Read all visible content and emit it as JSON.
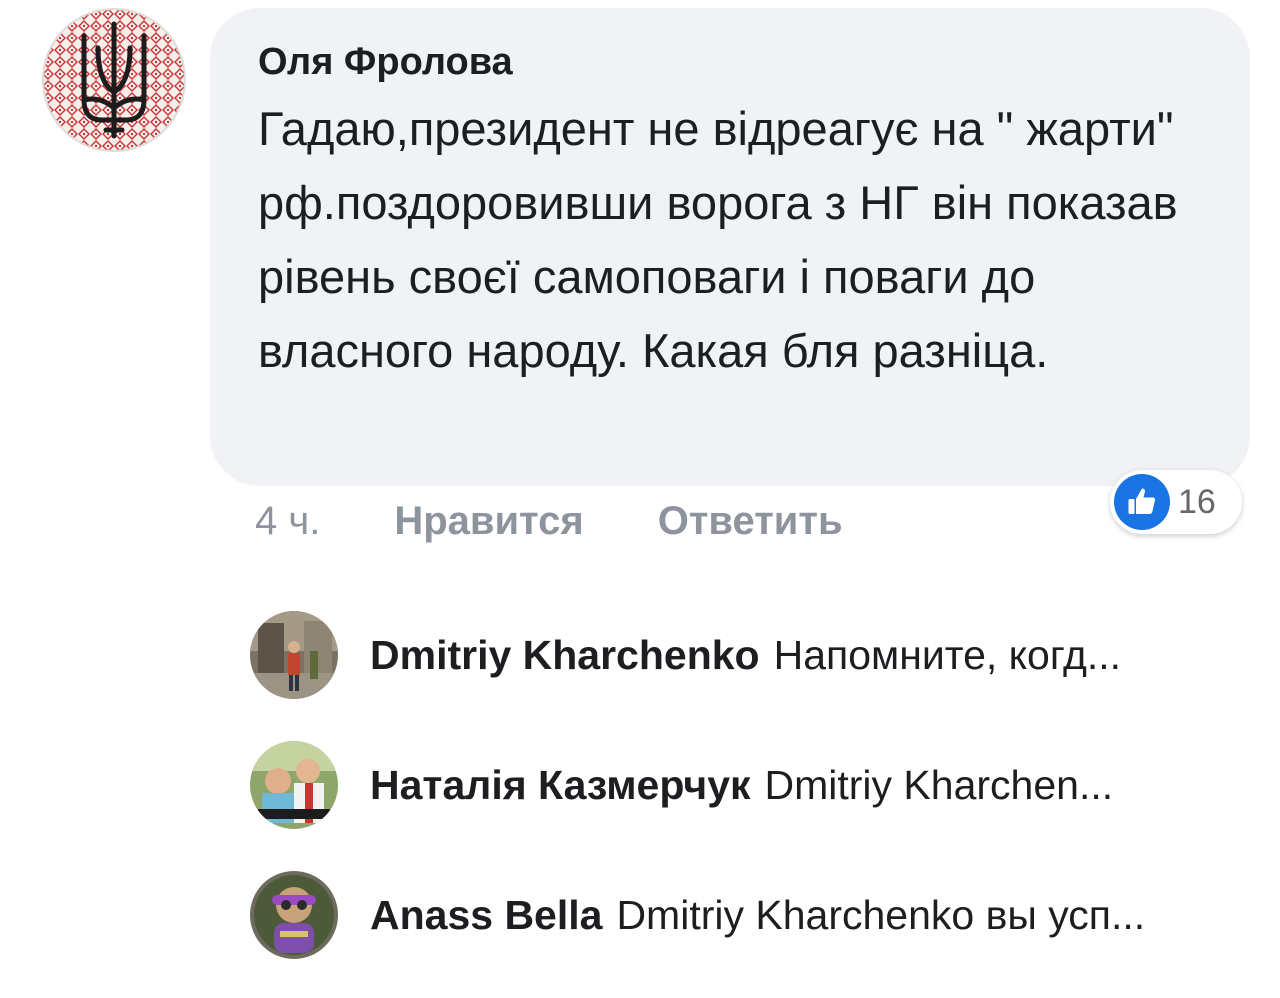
{
  "comment": {
    "author": "Оля Фролова",
    "text": "Гадаю,президент не відреагує на \" жарти\" рф.поздоровивши ворога з НГ він показав рівень своєї самоповаги і поваги до власного народу. Какая бля разніца.",
    "time": "4 ч.",
    "like_label": "Нравится",
    "reply_label": "Ответить",
    "reaction_count": "16",
    "reaction_color": "#1b74e4"
  },
  "replies": [
    {
      "name": "Dmitriy Kharchenko",
      "preview": "Напомните, когд..."
    },
    {
      "name": "Наталія Казмерчук",
      "preview": "Dmitriy Kharchen..."
    },
    {
      "name": "Anass Bella",
      "preview": "Dmitriy Kharchenko вы усп..."
    }
  ],
  "icons": {
    "author_avatar": "trident-embroidery-avatar",
    "reaction": "thumbs-up-icon"
  }
}
